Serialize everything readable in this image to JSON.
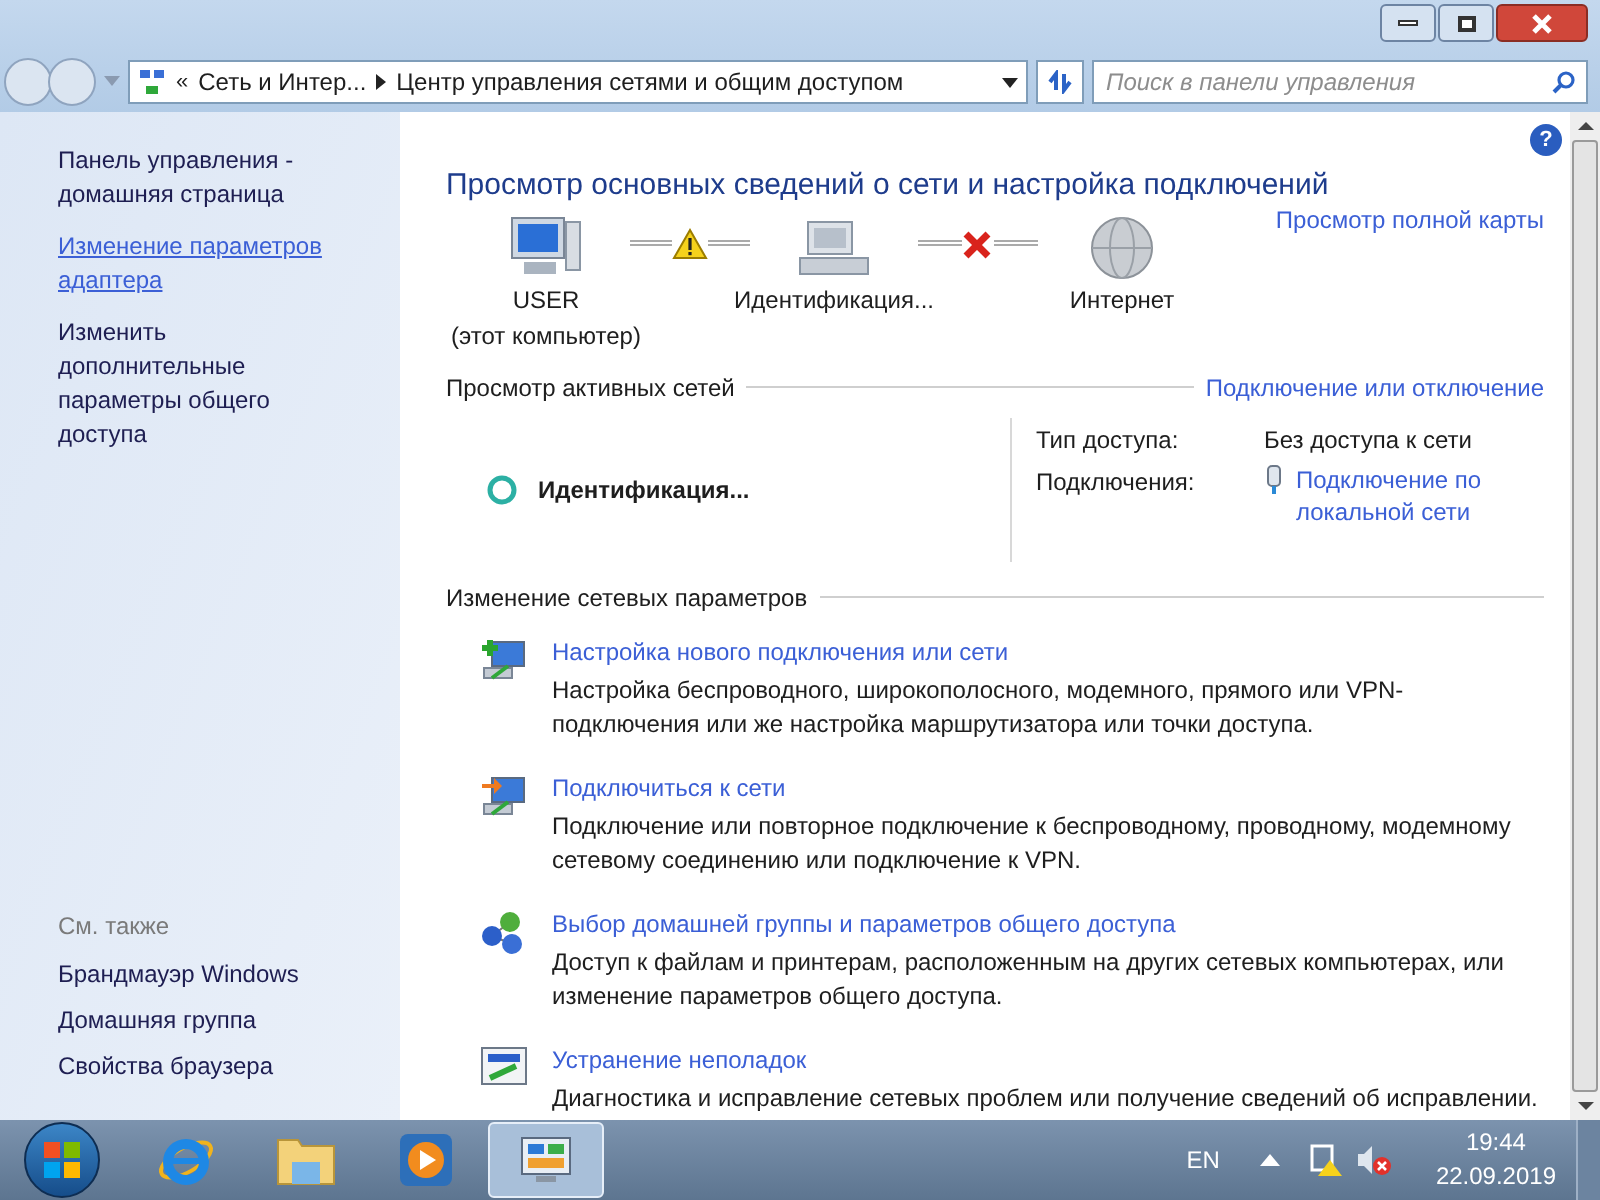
{
  "address_bar": {
    "overflow": "«",
    "crumbs": [
      "Сеть и Интер...",
      "Центр управления сетями и общим доступом"
    ]
  },
  "search": {
    "placeholder": "Поиск в панели управления"
  },
  "sidebar": {
    "items": [
      {
        "label": "Панель управления - домашняя страница",
        "hovered": false
      },
      {
        "label": "Изменение параметров адаптера",
        "hovered": true
      },
      {
        "label": "Изменить дополнительные параметры общего доступа",
        "hovered": false
      }
    ],
    "see_also": {
      "heading": "См. также",
      "items": [
        "Брандмауэр Windows",
        "Домашняя группа",
        "Свойства браузера"
      ]
    }
  },
  "main": {
    "help": "?",
    "title": "Просмотр основных сведений о сети и настройка подключений",
    "full_map_link": "Просмотр полной карты",
    "map": {
      "nodes": [
        {
          "kind": "computer",
          "label": "USER",
          "sublabel": "(этот компьютер)"
        },
        {
          "kind": "network",
          "label": "Идентификация..."
        },
        {
          "kind": "internet",
          "label": "Интернет"
        }
      ],
      "links": [
        {
          "kind": "warning"
        },
        {
          "kind": "error"
        }
      ]
    },
    "active_networks": {
      "heading": "Просмотр активных сетей",
      "connect_link": "Подключение или отключение",
      "network_name": "Идентификация...",
      "access_label": "Тип доступа:",
      "access_value": "Без доступа к сети",
      "connections_label": "Подключения:",
      "connection_link": "Подключение по локальной сети"
    },
    "change_settings": {
      "heading": "Изменение сетевых параметров",
      "tasks": [
        {
          "kind": "new",
          "link": "Настройка нового подключения или сети",
          "description": "Настройка беспроводного, широкополосного, модемного, прямого или VPN-подключения или же настройка маршрутизатора или точки доступа."
        },
        {
          "kind": "connect",
          "link": "Подключиться к сети",
          "description": "Подключение или повторное подключение к беспроводному, проводному, модемному сетевому соединению или подключение к VPN."
        },
        {
          "kind": "homegroup",
          "link": "Выбор домашней группы и параметров общего доступа",
          "description": "Доступ к файлам и принтерам, расположенным на других сетевых компьютерах, или изменение параметров общего доступа."
        },
        {
          "kind": "troubleshoot",
          "link": "Устранение неполадок",
          "description": "Диагностика и исправление сетевых проблем или получение сведений об исправлении."
        }
      ]
    }
  },
  "taskbar": {
    "apps": [
      {
        "kind": "ie",
        "selected": false
      },
      {
        "kind": "explorer",
        "selected": false
      },
      {
        "kind": "media",
        "selected": false
      },
      {
        "kind": "control",
        "selected": true
      }
    ],
    "language": "EN",
    "time": "19:44",
    "date": "22.09.2019"
  }
}
